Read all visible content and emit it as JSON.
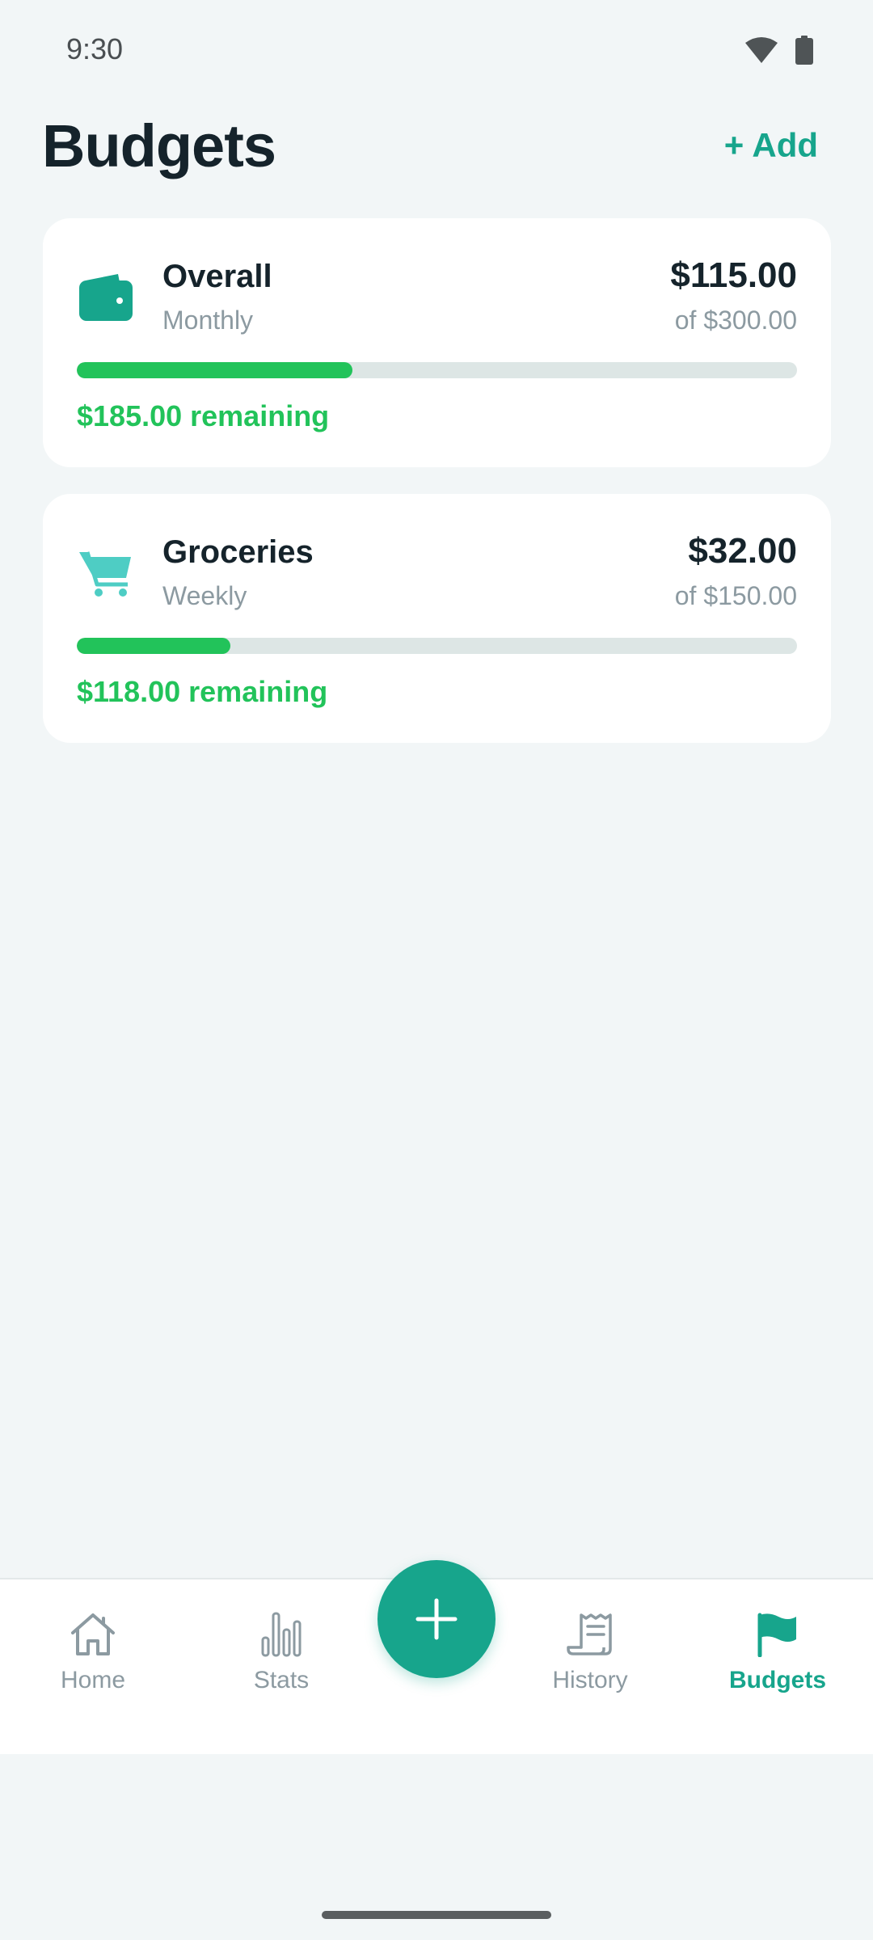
{
  "status_bar": {
    "time": "9:30",
    "icons": [
      "wifi-icon",
      "battery-icon"
    ]
  },
  "header": {
    "title": "Budgets",
    "add_label": "+ Add"
  },
  "budgets": [
    {
      "icon": "wallet-icon",
      "name": "Overall",
      "period": "Monthly",
      "spent": "$115.00",
      "limit": "of $300.00",
      "progress": 0.383,
      "remaining": "$185.00 remaining"
    },
    {
      "icon": "cart-icon",
      "name": "Groceries",
      "period": "Weekly",
      "spent": "$32.00",
      "limit": "of $150.00",
      "progress": 0.213,
      "remaining": "$118.00 remaining"
    }
  ],
  "nav": {
    "items": [
      {
        "label": "Home",
        "icon": "home-icon",
        "active": false
      },
      {
        "label": "Stats",
        "icon": "bar-chart-icon",
        "active": false
      },
      {
        "label": "History",
        "icon": "receipt-icon",
        "active": false
      },
      {
        "label": "Budgets",
        "icon": "flag-icon",
        "active": true
      }
    ],
    "fab_icon": "plus-icon"
  },
  "colors": {
    "accent": "#17a58c",
    "progress": "#22c35a",
    "background": "#f2f6f7",
    "muted_text": "#8c9aa1",
    "cart_icon": "#4ecdc4"
  }
}
